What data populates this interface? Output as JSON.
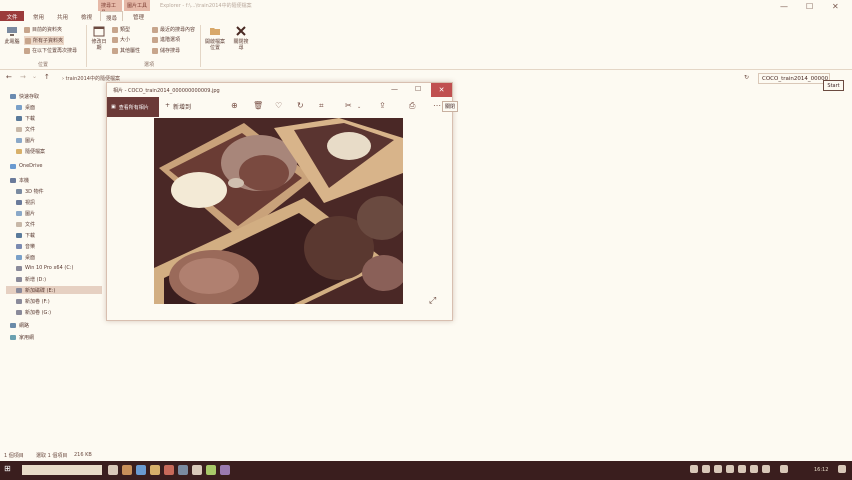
{
  "window": {
    "title_dim": "Explorer - f:\\...\\train2014中的隨便檔案"
  },
  "context_tabs": [
    "搜尋工具",
    "圖片工具"
  ],
  "tabs": [
    {
      "label": "文件"
    },
    {
      "label": "常用"
    },
    {
      "label": "共用"
    },
    {
      "label": "檢視"
    },
    {
      "label": "搜尋"
    },
    {
      "label": "管理"
    }
  ],
  "ribbon": {
    "location": {
      "thispc": "此電腦",
      "current": "目前的資料夾",
      "all_subfolders": "所有子資料夾",
      "search_again": "在以下位置再次搜尋",
      "group": "位置"
    },
    "refine": {
      "modified": "修改日期",
      "kind": "類型",
      "size": "大小",
      "other": "其他屬性",
      "recent": "最近的搜尋內容",
      "advanced": "進階選項",
      "save": "儲存搜尋",
      "group": "選項"
    },
    "open_location": "開啟檔案位置",
    "close_search": "關閉搜尋"
  },
  "address": {
    "path": "train2014中的隨便檔案",
    "search_value": "COCO_train2014_00000",
    "start_button": "Start"
  },
  "nav_pane": {
    "quick_access": "快速存取",
    "items": [
      "桌面",
      "下載",
      "文件",
      "圖片",
      "隨便檔案"
    ],
    "onedrive": "OneDrive",
    "thispc": "本機",
    "pc_items": [
      "3D 物件",
      "視訊",
      "圖片",
      "文件",
      "下載",
      "音樂",
      "桌面",
      "Win 10 Pro x64 (C:)",
      "新增 (D:)",
      "新加磁碟 (E:)",
      "新加卷 (F:)",
      "新加卷 (G:)"
    ],
    "network": "網路",
    "homegroup": "家用網"
  },
  "status": {
    "count": "1 個項目",
    "selected": "選取 1 個項目",
    "size": "216 KB"
  },
  "viewer": {
    "title": "相片 - COCO_train2014_000000000009.jpg",
    "collection": "查看所有相片",
    "add_to": "新增到",
    "close_tooltip": "關閉"
  },
  "taskbar": {
    "time": "16:12"
  },
  "colors": {
    "accent": "#9b3b3b",
    "taskbar": "#3a1e1e",
    "background": "#fdfaf2"
  }
}
